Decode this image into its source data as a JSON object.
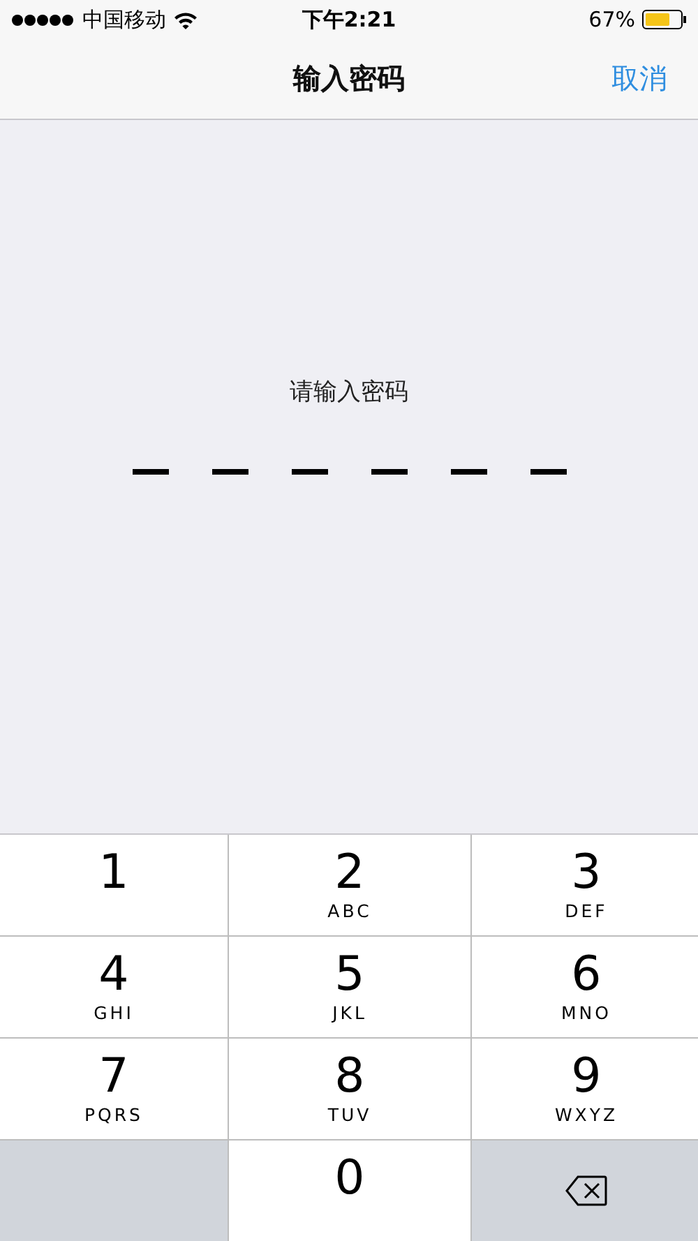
{
  "status_bar": {
    "carrier": "中国移动",
    "time": "下午2:21",
    "battery": "67%"
  },
  "nav_bar": {
    "title": "输入密码",
    "cancel": "取消"
  },
  "prompt": "请输入密码",
  "passcode_slots": [
    {
      "filled": false
    },
    {
      "filled": false
    },
    {
      "filled": false
    },
    {
      "filled": false
    },
    {
      "filled": false
    },
    {
      "filled": false
    }
  ],
  "keypad": [
    {
      "kind": "digit",
      "digit": "1"
    },
    {
      "kind": "digit",
      "digit": "2",
      "letters": "ABC"
    },
    {
      "kind": "digit",
      "digit": "3",
      "letters": "DEF"
    },
    {
      "kind": "digit",
      "digit": "4",
      "letters": "GHI"
    },
    {
      "kind": "digit",
      "digit": "5",
      "letters": "JKL"
    },
    {
      "kind": "digit",
      "digit": "6",
      "letters": "MNO"
    },
    {
      "kind": "digit",
      "digit": "7",
      "letters": "PQRS"
    },
    {
      "kind": "digit",
      "digit": "8",
      "letters": "TUV"
    },
    {
      "kind": "digit",
      "digit": "9",
      "letters": "WXYZ"
    },
    {
      "kind": "blank"
    },
    {
      "kind": "digit",
      "digit": "0"
    },
    {
      "kind": "delete"
    }
  ]
}
